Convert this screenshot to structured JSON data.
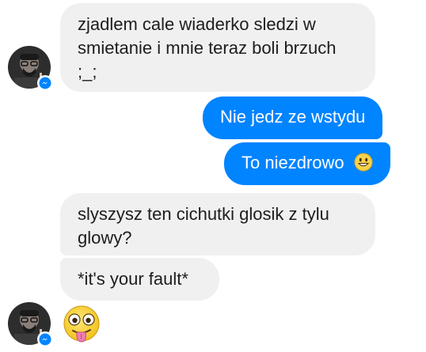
{
  "conversation": {
    "messages": [
      {
        "direction": "incoming",
        "text": "zjadlem cale wiaderko sledzi w smietanie i mnie teraz boli brzuch ;_;"
      },
      {
        "direction": "outgoing",
        "text": "Nie jedz ze wstydu"
      },
      {
        "direction": "outgoing",
        "text": "To niezdrowo",
        "emoji": "grinning-face-emoji"
      },
      {
        "direction": "incoming",
        "text": "slyszysz ten cichutki glosik z tylu glowy?"
      },
      {
        "direction": "incoming",
        "text": "*it's your fault*"
      },
      {
        "direction": "incoming",
        "emoji": "winking-tongue-face-emoji"
      }
    ],
    "avatar_badge_icon": "messenger-icon"
  },
  "colors": {
    "incoming_bubble": "#f1f0f0",
    "outgoing_bubble": "#0084ff",
    "outgoing_text": "#ffffff",
    "incoming_text": "#1d1d1d",
    "messenger_badge": "#0084ff"
  }
}
